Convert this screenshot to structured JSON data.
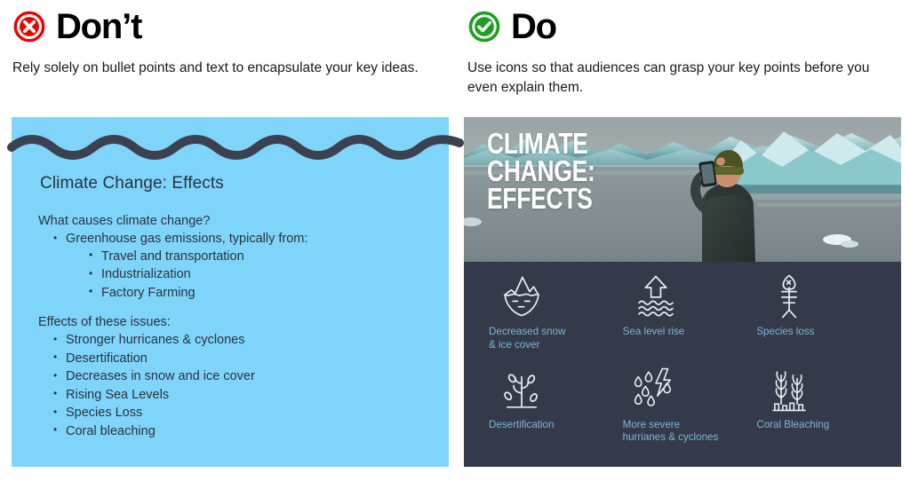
{
  "colors": {
    "dont_accent": "#ee0000",
    "do_accent": "#1f9e1f",
    "slide_blue": "#7ed5f9",
    "slide_dark": "#353a4a",
    "wave": "#3c4150",
    "icon_label": "#79b7d8",
    "body_text": "#2b3240"
  },
  "dont": {
    "icon": "circle-x-icon",
    "title": "Don’t",
    "subtitle": "Rely solely on bullet points and text to encapsulate your key ideas.",
    "slide": {
      "decoration": "wave-divider",
      "title": "Climate Change: Effects",
      "block_causes": {
        "lead": "What causes climate change?",
        "bullets": [
          {
            "text": "Greenhouse gas emissions, typically from:",
            "children": [
              "Travel and transportation",
              "Industrialization",
              "Factory Farming"
            ]
          }
        ]
      },
      "block_effects": {
        "lead": "Effects of these issues:",
        "bullets": [
          "Stronger hurricanes & cyclones",
          "Desertification",
          "Decreases in snow and ice cover",
          "Rising Sea Levels",
          "Species Loss",
          "Coral bleaching"
        ]
      }
    }
  },
  "do": {
    "icon": "circle-check-icon",
    "title": "Do",
    "subtitle": "Use icons so that audiences can grasp your key points before you even explain them.",
    "slide": {
      "photo_alt": "person photographing icebergs in a glacial lagoon",
      "title": "CLIMATE\nCHANGE:\nEFFECTS",
      "icons": [
        {
          "icon": "iceberg-icon",
          "label": "Decreased snow\n& ice cover"
        },
        {
          "icon": "sea-level-icon",
          "label": "Sea level rise"
        },
        {
          "icon": "fish-bones-icon",
          "label": "Species loss"
        },
        {
          "icon": "bare-tree-icon",
          "label": "Desertification"
        },
        {
          "icon": "storm-rain-icon",
          "label": "More severe\nhurrianes & cyclones"
        },
        {
          "icon": "coral-icon",
          "label": "Coral Bleaching"
        }
      ]
    }
  }
}
